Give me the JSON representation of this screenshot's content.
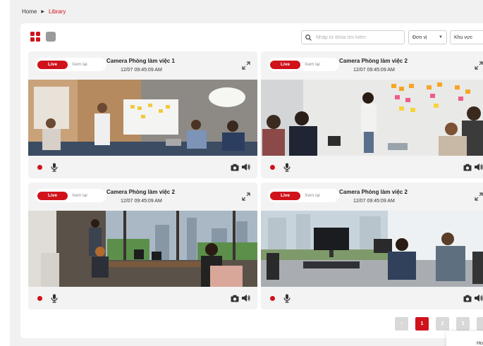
{
  "breadcrumb": {
    "home": "Home",
    "current": "Library"
  },
  "search": {
    "placeholder": "Nhập từ khóa tìm kiếm"
  },
  "filters": [
    {
      "label": "Đơn vị"
    },
    {
      "label": "Khu vực"
    }
  ],
  "cameras": [
    {
      "live": "Live",
      "replay": "Xem lại",
      "title": "Camera Phòng làm việc 1",
      "time": "12/07 09:45:09 AM"
    },
    {
      "live": "Live",
      "replay": "Xem lại",
      "title": "Camera Phòng làm việc 2",
      "time": "12/07 09:45:09 AM"
    },
    {
      "live": "Live",
      "replay": "Xem lại",
      "title": "Camera Phòng làm việc 2",
      "time": "12/07 09:45:09 AM"
    },
    {
      "live": "Live",
      "replay": "Xem lại",
      "title": "Camera Phòng làm việc 2",
      "time": "12/07 09:45:09 AM"
    }
  ],
  "pagination": {
    "pages": [
      "1",
      "2",
      "3",
      ""
    ],
    "active": "1"
  },
  "toast": {
    "text": "Ho"
  },
  "colors": {
    "accent": "#d0121b",
    "inactive": "#d9d9d9"
  }
}
